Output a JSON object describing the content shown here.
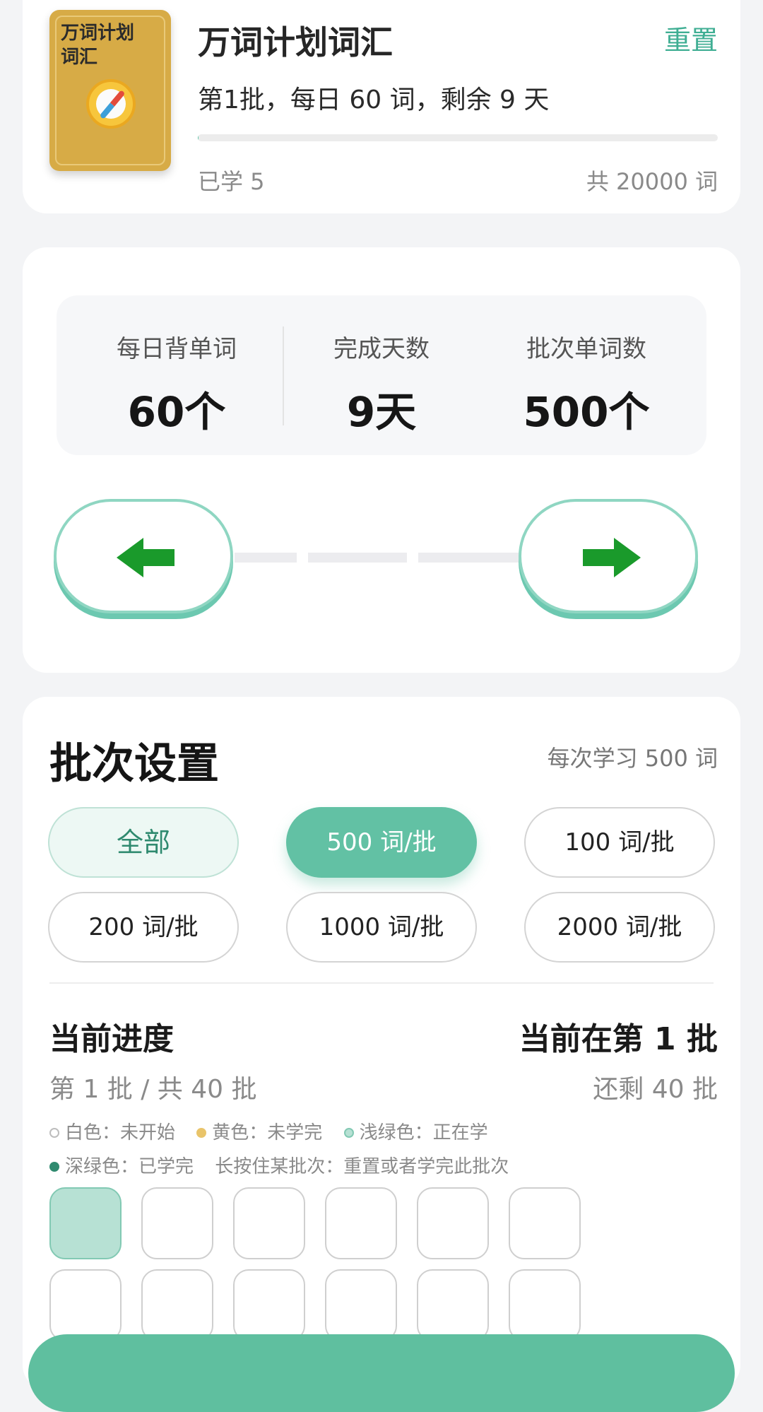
{
  "book": {
    "cover_title": "万词计划\n词汇",
    "title": "万词计划词汇",
    "reset_label": "重置",
    "subtitle": "第1批，每日 60 词，剩余 9 天",
    "learned": "已学 5",
    "total": "共 20000 词",
    "progress_fraction": 0.00025
  },
  "stats": [
    {
      "label": "每日背单词",
      "value": "60个"
    },
    {
      "label": "完成天数",
      "value": "9天"
    },
    {
      "label": "批次单词数",
      "value": "500个"
    }
  ],
  "nav": {
    "prev_icon": "arrow-left-icon",
    "next_icon": "arrow-right-icon",
    "arrow_color": "#1a9a2b"
  },
  "batch": {
    "title": "批次设置",
    "note": "每次学习 500 词",
    "chips": [
      "全部",
      "500 词/批",
      "100 词/批",
      "200 词/批",
      "1000 词/批",
      "2000 词/批"
    ],
    "selected": "500 词/批"
  },
  "progress": {
    "title": "当前进度",
    "current": "当前在第 1 批",
    "sub": "第 1 批 / 共 40 批",
    "remain": "还剩 40 批"
  },
  "legend": {
    "white": "白色：未开始",
    "yellow": "黄色：未学完",
    "lightgreen": "浅绿色：正在学",
    "darkgreen": "深绿色：已学完",
    "hint": "长按住某批次：重置或者学完此批次"
  },
  "colors": {
    "accent": "#62c1a4",
    "accent_text": "#3fae93",
    "yellow": "#e9c46a",
    "lightgreen": "#b7e1d4",
    "darkgreen": "#2f8a6f"
  }
}
